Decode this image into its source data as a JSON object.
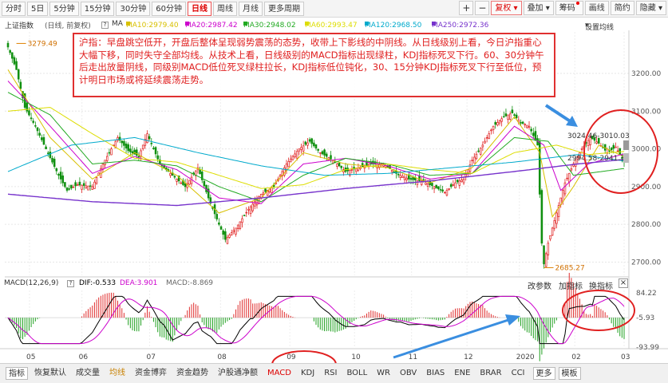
{
  "toolbar": {
    "periods": [
      "分时",
      "5日",
      "5分钟",
      "15分钟",
      "30分钟",
      "60分钟",
      "日线",
      "周线",
      "月线",
      "更多周期"
    ],
    "active_period": "日线",
    "plus": "+",
    "minus": "−",
    "fuquan": "复权",
    "right_items": [
      "叠加",
      "筹码",
      "画线",
      "简约",
      "隐藏"
    ]
  },
  "info": {
    "index_name": "上证指数",
    "mode": "(日线, 前复权)",
    "ma_label": "MA",
    "ma": [
      {
        "label": "MA10:2979.40",
        "color": "#d8c000"
      },
      {
        "label": "MA20:2987.42",
        "color": "#cc00cc"
      },
      {
        "label": "MA30:2948.02",
        "color": "#22aa22"
      },
      {
        "label": "MA60:2993.47",
        "color": "#dddd00"
      },
      {
        "label": "MA120:2968.50",
        "color": "#00aacc"
      },
      {
        "label": "MA250:2972.36",
        "color": "#7733cc"
      }
    ],
    "settings": "设置均线"
  },
  "annotation": "沪指：早盘跳空低开，开盘后整体呈现弱势震荡的态势，收带上下影线的中阴线。从日线级别上看，今日沪指重心大幅下移，同时失守全部均线。从技术上看，日线级别的MACD指标出现绿柱，KDJ指标死叉下行。60、30分钟午后走出放量阴线，同级别MACD低位死叉绿柱拉长，KDJ指标低位钝化，30、15分钟KDJ指标死叉下行至低位，预计明日市场或将延续震荡走势。",
  "price_labels": {
    "high": "3279.49",
    "low": "2685.27",
    "r1": "3024.46-3010.03",
    "r2": "2994.58-2941.37"
  },
  "macd": {
    "label": "MACD(12,26,9)",
    "dif": "DIF:-0.533",
    "dea": "DEA:3.901",
    "macd": "MACD:-8.869",
    "params": "改参数",
    "add": "加指标",
    "switch": "换指标",
    "close": "×"
  },
  "tabs": [
    "指标",
    "恢复默认",
    "成交量",
    "均线",
    "资金博弈",
    "资金趋势",
    "沪股通净额",
    "MACD",
    "KDJ",
    "RSI",
    "BOLL",
    "WR",
    "OBV",
    "BIAS",
    "ENE",
    "BRAR",
    "CCI",
    "更多",
    "模板"
  ],
  "chart_data": {
    "type": "candlestick",
    "title": "上证指数 (日线, 前复权)",
    "x_ticks": [
      "05",
      "06",
      "07",
      "08",
      "09",
      "10",
      "11",
      "12",
      "2020",
      "02",
      "03"
    ],
    "y_ticks": [
      3200,
      3100,
      3000,
      2900,
      2800,
      2700
    ],
    "ylim": [
      2665,
      3310
    ],
    "macd_ticks": [
      "84.22",
      "-5.93",
      "-93.99"
    ],
    "macd_ylim": [
      -93.99,
      84.22
    ],
    "key_levels": {
      "high": 3279.49,
      "low": 2685.27
    },
    "grid": true,
    "close_approx": [
      [
        0,
        3270
      ],
      [
        4,
        3210
      ],
      [
        8,
        3110
      ],
      [
        13,
        3060
      ],
      [
        18,
        3000
      ],
      [
        24,
        2930
      ],
      [
        28,
        2890
      ],
      [
        33,
        2905
      ],
      [
        40,
        2900
      ],
      [
        45,
        2960
      ],
      [
        52,
        3030
      ],
      [
        57,
        2995
      ],
      [
        62,
        2980
      ],
      [
        66,
        3040
      ],
      [
        72,
        2960
      ],
      [
        78,
        2930
      ],
      [
        84,
        2900
      ],
      [
        90,
        2950
      ],
      [
        95,
        2870
      ],
      [
        100,
        2800
      ],
      [
        103,
        2760
      ],
      [
        108,
        2790
      ],
      [
        114,
        2840
      ],
      [
        120,
        2880
      ],
      [
        126,
        2900
      ],
      [
        132,
        2960
      ],
      [
        138,
        3000
      ],
      [
        143,
        3020
      ],
      [
        148,
        2990
      ],
      [
        154,
        2970
      ],
      [
        160,
        2940
      ],
      [
        166,
        2950
      ],
      [
        172,
        2960
      ],
      [
        178,
        2960
      ],
      [
        184,
        2935
      ],
      [
        190,
        2920
      ],
      [
        196,
        2915
      ],
      [
        202,
        2900
      ],
      [
        207,
        2885
      ],
      [
        212,
        2910
      ],
      [
        216,
        2920
      ],
      [
        220,
        2970
      ],
      [
        225,
        3010
      ],
      [
        230,
        3060
      ],
      [
        235,
        3085
      ],
      [
        239,
        3095
      ],
      [
        243,
        3070
      ],
      [
        247,
        3060
      ],
      [
        251,
        3010
      ],
      [
        253,
        2750
      ],
      [
        254,
        2695
      ],
      [
        256,
        2750
      ],
      [
        260,
        2830
      ],
      [
        264,
        2910
      ],
      [
        268,
        2960
      ],
      [
        272,
        3000
      ],
      [
        276,
        3030
      ],
      [
        280,
        3015
      ],
      [
        284,
        2990
      ],
      [
        288,
        3005
      ],
      [
        292,
        2965
      ]
    ],
    "series": [
      {
        "name": "MA10",
        "values": [
          [
            0,
            3210
          ],
          [
            20,
            3030
          ],
          [
            40,
            2920
          ],
          [
            60,
            2990
          ],
          [
            80,
            2930
          ],
          [
            100,
            2830
          ],
          [
            120,
            2870
          ],
          [
            140,
            2990
          ],
          [
            160,
            2960
          ],
          [
            180,
            2950
          ],
          [
            200,
            2910
          ],
          [
            220,
            2950
          ],
          [
            240,
            3085
          ],
          [
            252,
            2990
          ],
          [
            258,
            2820
          ],
          [
            268,
            2900
          ],
          [
            280,
            3010
          ],
          [
            292,
            2979
          ]
        ]
      },
      {
        "name": "MA20",
        "values": [
          [
            0,
            3180
          ],
          [
            20,
            3060
          ],
          [
            40,
            2935
          ],
          [
            60,
            2980
          ],
          [
            80,
            2945
          ],
          [
            100,
            2870
          ],
          [
            120,
            2855
          ],
          [
            140,
            2960
          ],
          [
            160,
            2975
          ],
          [
            180,
            2955
          ],
          [
            200,
            2920
          ],
          [
            220,
            2935
          ],
          [
            240,
            3060
          ],
          [
            254,
            3010
          ],
          [
            262,
            2890
          ],
          [
            275,
            2960
          ],
          [
            292,
            2987
          ]
        ]
      },
      {
        "name": "MA30",
        "values": [
          [
            0,
            3150
          ],
          [
            20,
            3090
          ],
          [
            40,
            2960
          ],
          [
            60,
            2970
          ],
          [
            80,
            2955
          ],
          [
            100,
            2900
          ],
          [
            120,
            2860
          ],
          [
            140,
            2930
          ],
          [
            160,
            2975
          ],
          [
            180,
            2960
          ],
          [
            200,
            2930
          ],
          [
            220,
            2935
          ],
          [
            240,
            3030
          ],
          [
            256,
            3020
          ],
          [
            268,
            2930
          ],
          [
            292,
            2948
          ]
        ]
      },
      {
        "name": "MA60",
        "values": [
          [
            0,
            3100
          ],
          [
            20,
            3110
          ],
          [
            40,
            3040
          ],
          [
            60,
            2975
          ],
          [
            80,
            2965
          ],
          [
            100,
            2930
          ],
          [
            120,
            2895
          ],
          [
            140,
            2905
          ],
          [
            160,
            2945
          ],
          [
            180,
            2960
          ],
          [
            200,
            2945
          ],
          [
            220,
            2935
          ],
          [
            240,
            2990
          ],
          [
            260,
            3010
          ],
          [
            275,
            2985
          ],
          [
            292,
            2993
          ]
        ]
      },
      {
        "name": "MA120",
        "values": [
          [
            0,
            2940
          ],
          [
            30,
            3010
          ],
          [
            60,
            3030
          ],
          [
            90,
            2990
          ],
          [
            120,
            2955
          ],
          [
            150,
            2930
          ],
          [
            180,
            2935
          ],
          [
            210,
            2950
          ],
          [
            240,
            2965
          ],
          [
            270,
            2985
          ],
          [
            292,
            2968
          ]
        ]
      },
      {
        "name": "MA250",
        "values": [
          [
            0,
            2880
          ],
          [
            40,
            2860
          ],
          [
            80,
            2850
          ],
          [
            120,
            2870
          ],
          [
            160,
            2895
          ],
          [
            200,
            2915
          ],
          [
            240,
            2940
          ],
          [
            270,
            2960
          ],
          [
            292,
            2972
          ]
        ]
      }
    ]
  }
}
